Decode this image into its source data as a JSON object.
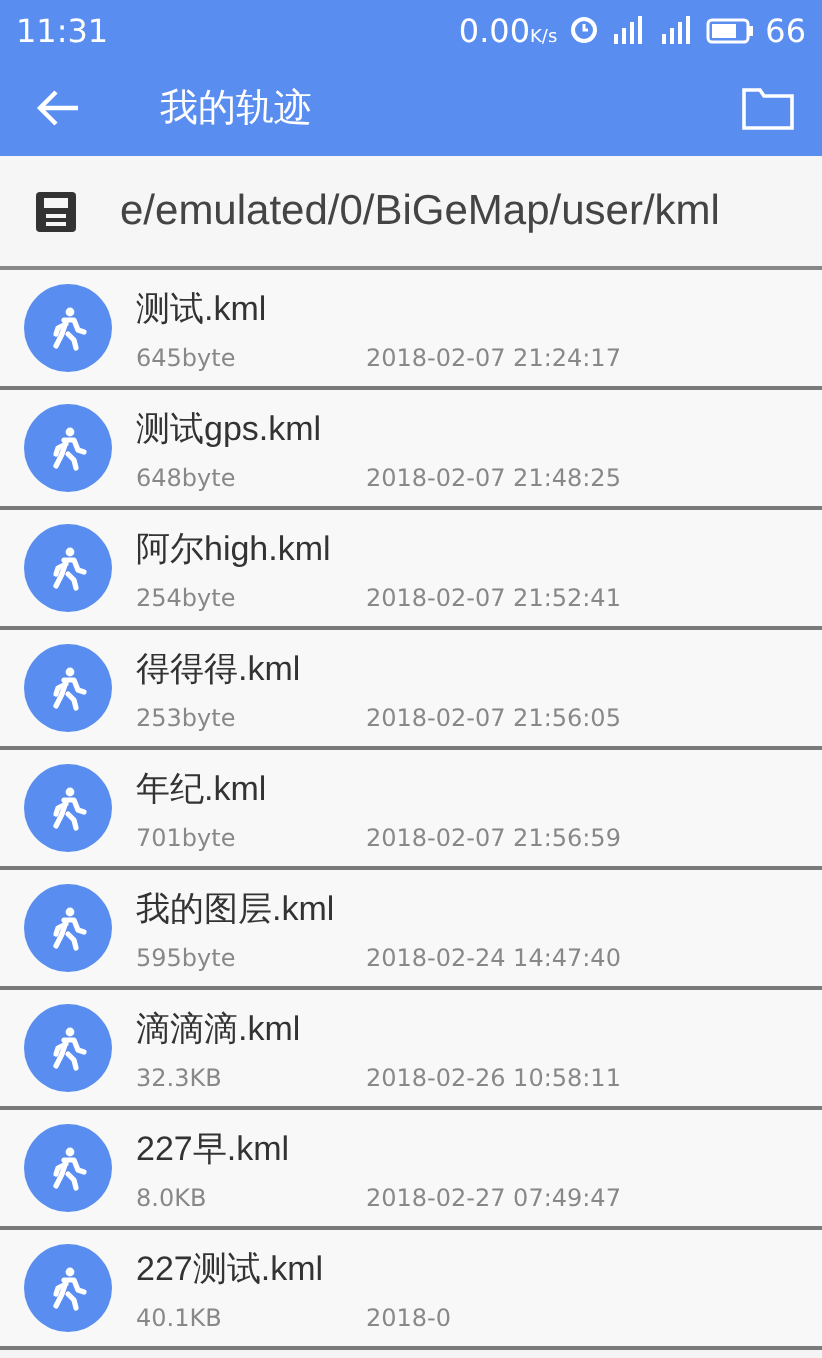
{
  "status_bar": {
    "time": "11:31",
    "speed": "0.00",
    "speed_unit": "K/s",
    "battery": "66"
  },
  "app_bar": {
    "title": "我的轨迹"
  },
  "path_bar": {
    "path": "e/emulated/0/BiGeMap/user/kml"
  },
  "files": [
    {
      "name": "测试.kml",
      "size": "645byte",
      "date": "2018-02-07 21:24:17"
    },
    {
      "name": "测试gps.kml",
      "size": "648byte",
      "date": "2018-02-07 21:48:25"
    },
    {
      "name": "阿尔high.kml",
      "size": "254byte",
      "date": "2018-02-07 21:52:41"
    },
    {
      "name": "得得得.kml",
      "size": "253byte",
      "date": "2018-02-07 21:56:05"
    },
    {
      "name": "年纪.kml",
      "size": "701byte",
      "date": "2018-02-07 21:56:59"
    },
    {
      "name": "我的图层.kml",
      "size": "595byte",
      "date": "2018-02-24 14:47:40"
    },
    {
      "name": "滴滴滴.kml",
      "size": "32.3KB",
      "date": "2018-02-26 10:58:11"
    },
    {
      "name": "227早.kml",
      "size": "8.0KB",
      "date": "2018-02-27 07:49:47"
    },
    {
      "name": "227测试.kml",
      "size": "40.1KB",
      "date": "2018-0"
    }
  ]
}
